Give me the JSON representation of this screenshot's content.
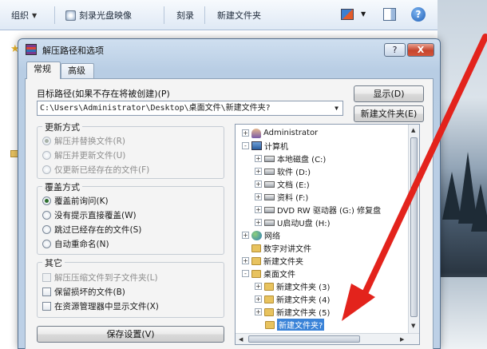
{
  "explorer": {
    "toolbar": {
      "organize": "组织",
      "burn_image": "刻录光盘映像",
      "burn": "刻录",
      "new_folder": "新建文件夹"
    }
  },
  "dialog": {
    "title": "解压路径和选项",
    "help_button": "?",
    "close_button": "X",
    "tabs": [
      {
        "label": "常规",
        "active": true
      },
      {
        "label": "高级",
        "active": false
      }
    ],
    "target_path": {
      "label": "目标路径(如果不存在将被创建)(P)",
      "value": "C:\\Users\\Administrator\\Desktop\\桌面文件\\新建文件夹?"
    },
    "buttons": {
      "show": "显示(D)",
      "new_folder": "新建文件夹(E)",
      "save_settings": "保存设置(V)"
    },
    "update_mode": {
      "title": "更新方式",
      "options": [
        {
          "label": "解压并替换文件(R)",
          "selected": true
        },
        {
          "label": "解压并更新文件(U)",
          "selected": false
        },
        {
          "label": "仅更新已经存在的文件(F)",
          "selected": false
        }
      ]
    },
    "overwrite_mode": {
      "title": "覆盖方式",
      "options": [
        {
          "label": "覆盖前询问(K)",
          "selected": true
        },
        {
          "label": "没有提示直接覆盖(W)",
          "selected": false
        },
        {
          "label": "跳过已经存在的文件(S)",
          "selected": false
        },
        {
          "label": "自动重命名(N)",
          "selected": false
        }
      ]
    },
    "misc": {
      "title": "其它",
      "options": [
        {
          "label": "解压压缩文件到子文件夹(L)",
          "disabled": true
        },
        {
          "label": "保留损坏的文件(B)",
          "disabled": false
        },
        {
          "label": "在资源管理器中显示文件(X)",
          "disabled": false
        }
      ]
    },
    "tree": [
      {
        "label": "Administrator",
        "icon": "user",
        "expander": "+"
      },
      {
        "label": "计算机",
        "icon": "computer",
        "expander": "-"
      },
      {
        "label": "本地磁盘 (C:)",
        "icon": "drive",
        "expander": "+"
      },
      {
        "label": "软件 (D:)",
        "icon": "drive",
        "expander": "+"
      },
      {
        "label": "文档 (E:)",
        "icon": "drive",
        "expander": "+"
      },
      {
        "label": "资料 (F:)",
        "icon": "drive",
        "expander": "+"
      },
      {
        "label": "DVD RW 驱动器 (G:) 修复盘",
        "icon": "drive",
        "expander": "+"
      },
      {
        "label": "U启动U盘 (H:)",
        "icon": "drive",
        "expander": "+"
      },
      {
        "label": "网络",
        "icon": "network",
        "expander": "+"
      },
      {
        "label": "数字对讲文件",
        "icon": "folder",
        "expander": ""
      },
      {
        "label": "新建文件夹",
        "icon": "folder",
        "expander": "+"
      },
      {
        "label": "桌面文件",
        "icon": "folder",
        "expander": "-"
      },
      {
        "label": "新建文件夹 (3)",
        "icon": "folder",
        "expander": "+"
      },
      {
        "label": "新建文件夹 (4)",
        "icon": "folder",
        "expander": "+"
      },
      {
        "label": "新建文件夹 (5)",
        "icon": "folder",
        "expander": "+"
      },
      {
        "label": "新建文件夹?",
        "icon": "folder",
        "expander": "",
        "selected": true
      }
    ]
  },
  "colors": {
    "selection": "#3a83d8",
    "annotation_arrow": "#e3231c",
    "close_button": "#c6452e"
  }
}
